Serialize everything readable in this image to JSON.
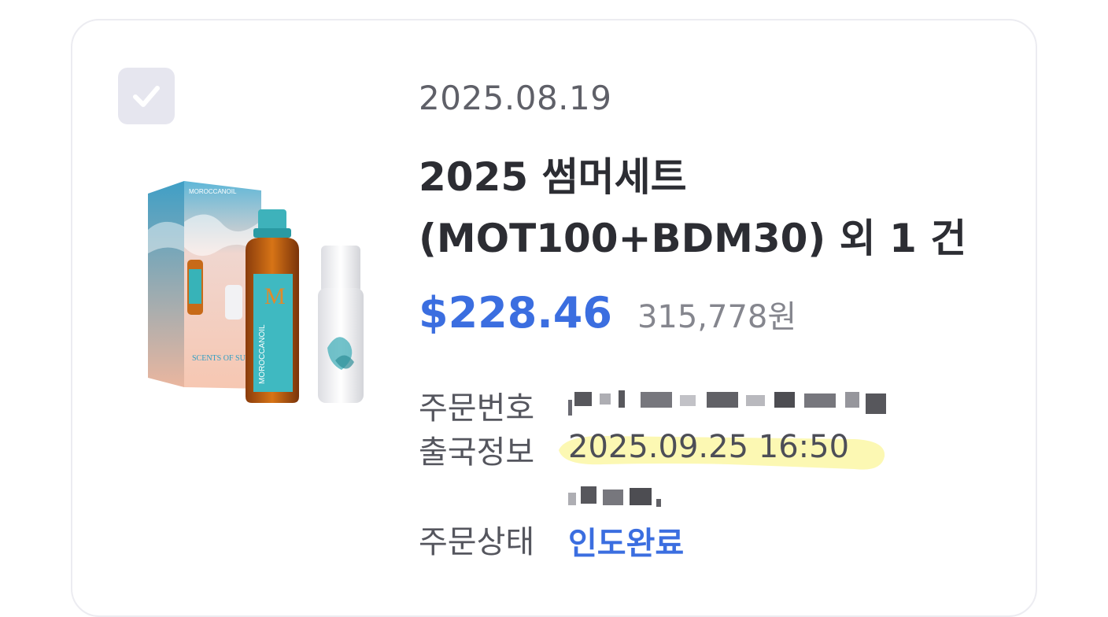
{
  "order": {
    "date": "2025.08.19",
    "title": "2025 썸머세트(MOT100+BDM30) 외 1 건",
    "price_usd": "$228.46",
    "price_krw": "315,778원",
    "order_number_label": "주문번호",
    "departure_label": "출국정보",
    "departure_value": "2025.09.25 16:50",
    "status_label": "주문상태",
    "status_value": "인도완료"
  },
  "product_image": {
    "brand": "MOROCCANOIL",
    "box_text": "SCENTS OF SUMMER",
    "monogram": "M"
  },
  "colors": {
    "accent": "#3b6ee0",
    "checkbox_bg": "#e6e6ef",
    "highlight": "#fbf7a6"
  },
  "icons": {
    "checkbox": "check-icon"
  }
}
